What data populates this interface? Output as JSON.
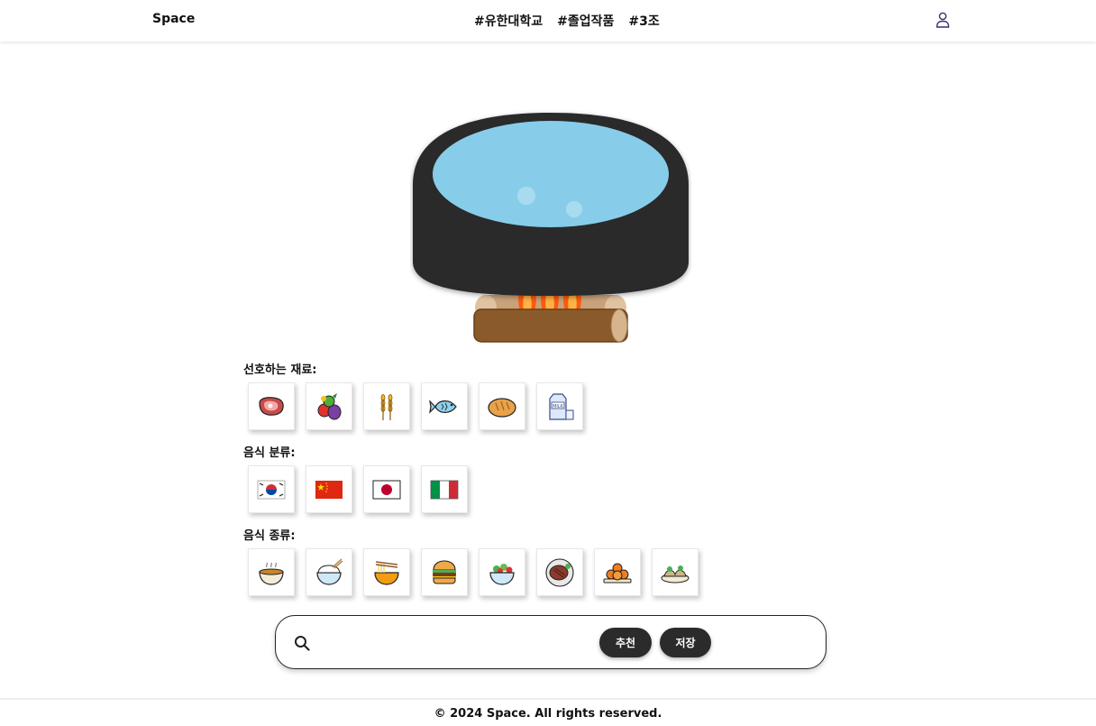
{
  "header": {
    "brand": "Space",
    "nav": [
      "#유한대학교",
      "#졸업작품",
      "#3조"
    ],
    "user_icon": "user-icon"
  },
  "sections": {
    "ingredients": {
      "title": "선호하는 재료:",
      "items": [
        "meat-icon",
        "vegetables-icon",
        "wheat-icon",
        "fish-icon",
        "bread-icon",
        "milk-icon"
      ]
    },
    "cuisine": {
      "title": "음식 분류:",
      "items": [
        "korea-flag-icon",
        "china-flag-icon",
        "japan-flag-icon",
        "italy-flag-icon"
      ]
    },
    "food_type": {
      "title": "음식 종류:",
      "items": [
        "soup-icon",
        "rice-bowl-icon",
        "noodles-icon",
        "burger-icon",
        "salad-icon",
        "steak-icon",
        "fried-balls-icon",
        "dumplings-icon"
      ]
    }
  },
  "search": {
    "placeholder": "",
    "value": "",
    "recommend_label": "추천",
    "save_label": "저장"
  },
  "footer": {
    "text": "© 2024 Space. All rights reserved."
  },
  "colors": {
    "pot": "#2a2a2a",
    "water": "#87cdea",
    "log": "#8b5a2b",
    "flame": "#ff5a0a",
    "button": "#2b2b2b"
  }
}
